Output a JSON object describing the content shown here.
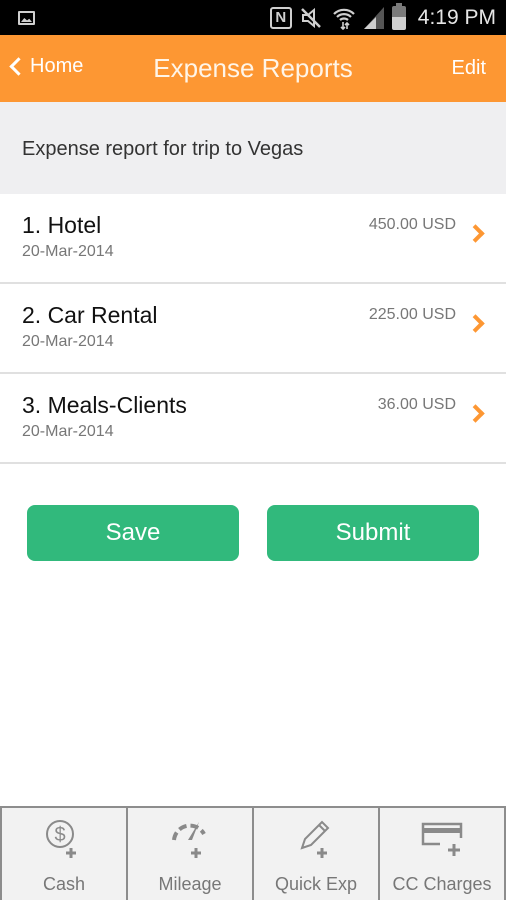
{
  "status_bar": {
    "time": "4:19 PM",
    "icons": [
      "image-icon",
      "nfc-icon",
      "mute-icon",
      "wifi-icon",
      "signal-icon",
      "battery-icon"
    ]
  },
  "header": {
    "back_label": "Home",
    "title": "Expense Reports",
    "edit_label": "Edit",
    "accent_color": "#fd9733"
  },
  "report": {
    "description": "Expense report for trip to Vegas"
  },
  "expenses": [
    {
      "name": "1. Hotel",
      "date": "20-Mar-2014",
      "amount": "450.00 USD"
    },
    {
      "name": "2. Car Rental",
      "date": "20-Mar-2014",
      "amount": "225.00 USD"
    },
    {
      "name": "3. Meals-Clients",
      "date": "20-Mar-2014",
      "amount": "36.00 USD"
    }
  ],
  "actions": {
    "save_label": "Save",
    "submit_label": "Submit",
    "button_color": "#31b97c"
  },
  "tabs": [
    {
      "label": "Cash",
      "icon": "cash-add-icon"
    },
    {
      "label": "Mileage",
      "icon": "mileage-add-icon"
    },
    {
      "label": "Quick Exp",
      "icon": "quick-expense-add-icon"
    },
    {
      "label": "CC Charges",
      "icon": "credit-card-add-icon"
    }
  ]
}
